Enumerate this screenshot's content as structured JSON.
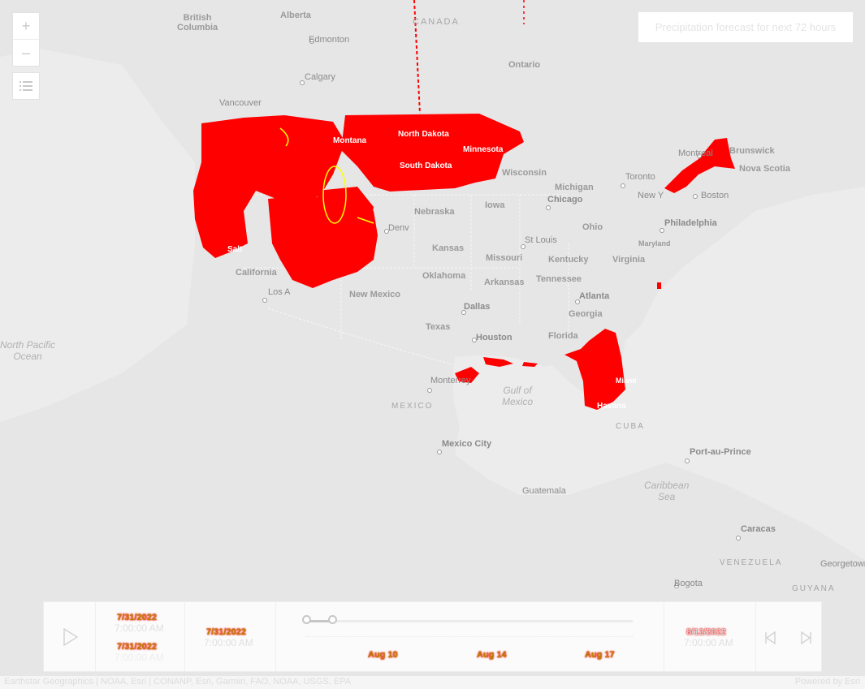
{
  "title_box": "Precipitation forecast for next 72 hours",
  "zoom": {
    "in": "+",
    "out": "–"
  },
  "legend_icon": "legend-list-icon",
  "labels": {
    "british_columbia": "British\nColumbia",
    "alberta": "Alberta",
    "canada": "CANADA",
    "edmonton": "Edmonton",
    "calgary": "Calgary",
    "ontario": "Ontario",
    "vancouver": "Vancouver",
    "north_dakota": "North Dakota",
    "south_dakota": "South Dakota",
    "minnesota": "Minnesota",
    "montana": "Montana",
    "wisconsin": "Wisconsin",
    "michigan": "Michigan",
    "toronto": "Toronto",
    "montreal": "Montreal",
    "new_brunswick": "Brunswick",
    "nova_scotia": "Nova Scotia",
    "boston": "Boston",
    "new_york": "New Y",
    "chicago": "Chicago",
    "iowa": "Iowa",
    "nebraska": "Nebraska",
    "ohio": "Ohio",
    "philadelphia": "Philadelphia",
    "denver": "Denv",
    "kansas": "Kansas",
    "st_louis": "St Louis",
    "missouri": "Missouri",
    "kentucky": "Kentucky",
    "virginia": "Virginia",
    "maryland": "Maryland",
    "california": "California",
    "los_angeles": "Los A",
    "oklahoma": "Oklahoma",
    "arkansas": "Arkansas",
    "tennessee": "Tennessee",
    "new_mexico": "New Mexico",
    "atlanta": "Atlanta",
    "georgia": "Georgia",
    "dallas": "Dallas",
    "texas": "Texas",
    "houston": "Houston",
    "florida": "Florida",
    "miami": "Miami",
    "havana": "Havana",
    "cuba": "CUBA",
    "north_pacific": "North Pacific\nOcean",
    "monterrey": "Monterrey",
    "mexico": "MEXICO",
    "gulf_of_mexico": "Gulf of\nMexico",
    "mexico_city": "Mexico City",
    "port_au_prince": "Port-au-Prince",
    "guatemala": "Guatemala",
    "caribbean": "Caribbean\nSea",
    "caracas": "Caracas",
    "venezuela": "VENEZUELA",
    "bogota": "Bogota",
    "georgetown": "Georgetown",
    "guyana": "GUYANA",
    "salt": "Salt"
  },
  "time_slider": {
    "full_start_date": "7/31/2022",
    "full_start_time": "7:00:00 AM",
    "full_end_date": "7/31/2022",
    "full_end_time": "7:00:00 AM",
    "current_date": "7/31/2022",
    "current_time": "7:00:00 AM",
    "end_date": "8/12/2022",
    "end_time": "7:00:00 AM",
    "ticks": [
      "Aug 10",
      "Aug 14",
      "Aug 17"
    ],
    "position_start_fraction": 0.0,
    "position_end_fraction": 0.08
  },
  "attribution": {
    "sources": "Earthstar Geographics | NOAA, Esri | CONANP, Esri, Garmin, FAO, NOAA, USGS, EPA",
    "powered": "Powered by Esri"
  },
  "colors": {
    "precip": "#ff0000",
    "precip_edge": "#ffff00"
  }
}
